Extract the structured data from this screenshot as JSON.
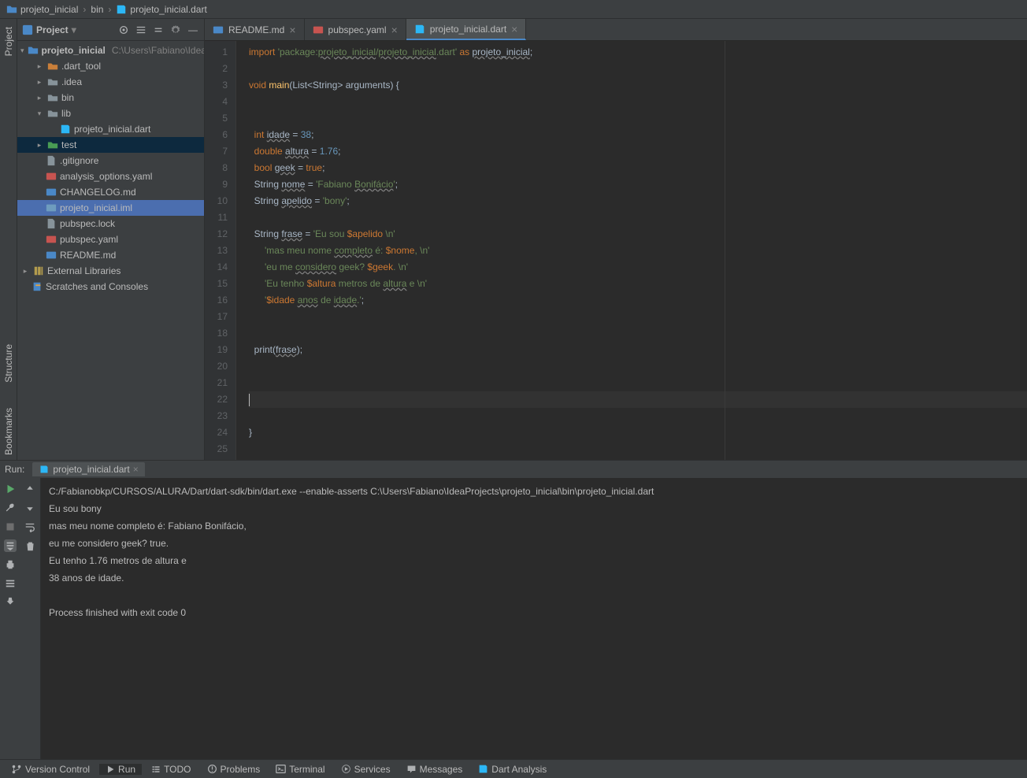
{
  "breadcrumb": {
    "items": [
      "projeto_inicial",
      "bin",
      "projeto_inicial.dart"
    ]
  },
  "project_panel": {
    "header_label": "Project"
  },
  "tree": {
    "root": {
      "label": "projeto_inicial",
      "hint": "C:\\Users\\Fabiano\\Idea"
    },
    "items": [
      {
        "label": ".dart_tool"
      },
      {
        "label": ".idea"
      },
      {
        "label": "bin"
      },
      {
        "label": "lib"
      },
      {
        "label": "projeto_inicial.dart"
      },
      {
        "label": "test"
      },
      {
        "label": ".gitignore"
      },
      {
        "label": "analysis_options.yaml"
      },
      {
        "label": "CHANGELOG.md"
      },
      {
        "label": "projeto_inicial.iml"
      },
      {
        "label": "pubspec.lock"
      },
      {
        "label": "pubspec.yaml"
      },
      {
        "label": "README.md"
      }
    ],
    "external": "External Libraries",
    "scratches": "Scratches and Consoles"
  },
  "tabs": {
    "t0": "README.md",
    "t1": "pubspec.yaml",
    "t2": "projeto_inicial.dart"
  },
  "code": {
    "l1a": "import ",
    "l1b": "'package:",
    "l1c": "projeto_inicial",
    "l1d": "/",
    "l1e": "projeto_inicial",
    "l1f": ".dart'",
    "l1g": " as ",
    "l1h": "projeto_inicial",
    "l1i": ";",
    "l3a": "void ",
    "l3b": "main",
    "l3c": "(List<String> arguments) {",
    "l6a": "  int ",
    "l6b": "idade",
    "l6c": " = ",
    "l6d": "38",
    "l6e": ";",
    "l7a": "  double ",
    "l7b": "altura",
    "l7c": " = ",
    "l7d": "1.76",
    "l7e": ";",
    "l8a": "  bool ",
    "l8b": "geek",
    "l8c": " = ",
    "l8d": "true",
    "l8e": ";",
    "l9a": "  String ",
    "l9b": "nome",
    "l9c": " = ",
    "l9d": "'Fabiano ",
    "l9e": "Bonifácio",
    "l9f": "'",
    "l9g": ";",
    "l10a": "  String ",
    "l10b": "apelido",
    "l10c": " = ",
    "l10d": "'bony'",
    "l10e": ";",
    "l12a": "  String ",
    "l12b": "frase",
    "l12c": " = ",
    "l12d": "'Eu sou ",
    "l12e": "$apelido",
    "l12f": " \\n'",
    "l13a": "      ",
    "l13b": "'mas meu nome ",
    "l13c": "completo",
    "l13d": " é: ",
    "l13e": "$nome",
    "l13f": ", ",
    "l13g": "\\n'",
    "l14a": "      ",
    "l14b": "'eu me ",
    "l14c": "considero",
    "l14d": " geek? ",
    "l14e": "$geek",
    "l14f": ". ",
    "l14g": "\\n'",
    "l15a": "      ",
    "l15b": "'Eu tenho ",
    "l15c": "$altura",
    "l15d": " metros de ",
    "l15e": "altura",
    "l15f": " e ",
    "l15g": "\\n'",
    "l16a": "      ",
    "l16b": "'",
    "l16c": "$idade",
    "l16d": " ",
    "l16e": "anos",
    "l16f": " de ",
    "l16g": "idade",
    "l16h": ".'",
    "l16i": ";",
    "l19a": "  print(",
    "l19b": "frase",
    "l19c": ");",
    "l24a": "}"
  },
  "run": {
    "label": "Run:",
    "tab": "projeto_inicial.dart",
    "out0": "C:/Fabianobkp/CURSOS/ALURA/Dart/dart-sdk/bin/dart.exe --enable-asserts C:\\Users\\Fabiano\\IdeaProjects\\projeto_inicial\\bin\\projeto_inicial.dart",
    "out1": "Eu sou bony",
    "out2": "mas meu nome completo é: Fabiano Bonifácio,",
    "out3": "eu me considero geek? true.",
    "out4": "Eu tenho 1.76 metros de altura e",
    "out5": "38 anos de idade.",
    "out6": "",
    "out7": "Process finished with exit code 0"
  },
  "bottombar": {
    "vcs": "Version Control",
    "run": "Run",
    "todo": "TODO",
    "problems": "Problems",
    "terminal": "Terminal",
    "services": "Services",
    "messages": "Messages",
    "dart": "Dart Analysis"
  },
  "side": {
    "project": "Project",
    "structure": "Structure",
    "bookmarks": "Bookmarks"
  }
}
